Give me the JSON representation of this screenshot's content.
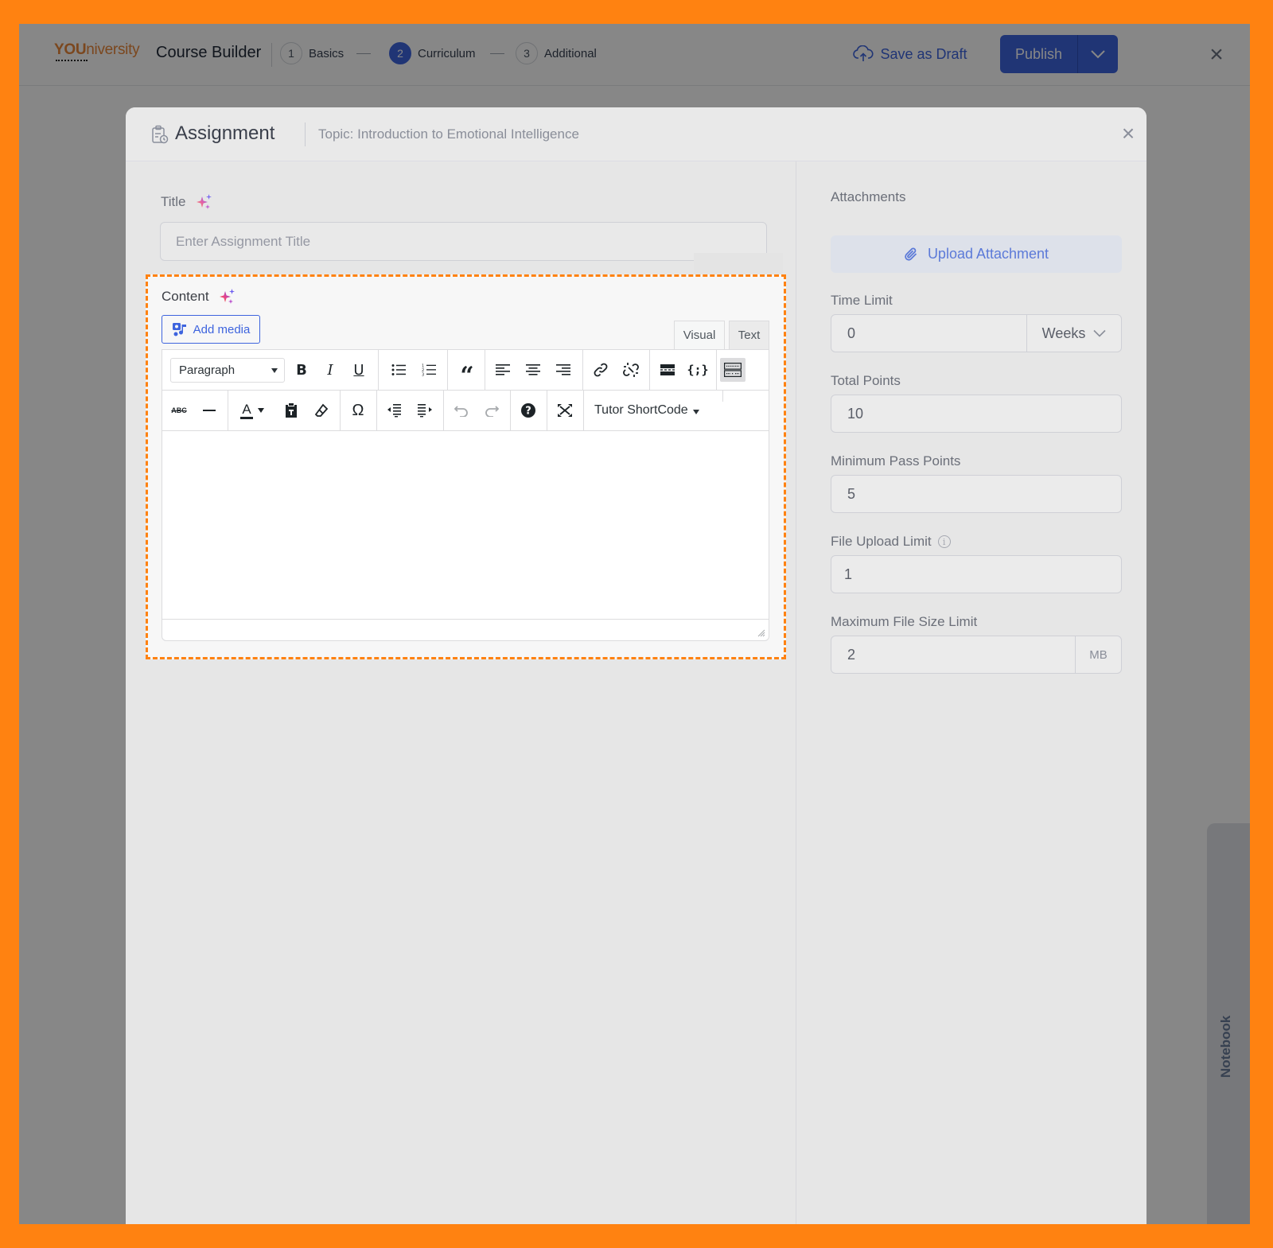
{
  "app": {
    "logo": {
      "bold": "YOU",
      "rest": "niversity"
    },
    "title": "Course Builder",
    "steps": [
      {
        "num": "1",
        "label": "Basics",
        "active": false
      },
      {
        "num": "2",
        "label": "Curriculum",
        "active": true
      },
      {
        "num": "3",
        "label": "Additional",
        "active": false
      }
    ],
    "save_draft_label": "Save as Draft",
    "publish_label": "Publish",
    "close_glyph": "×",
    "accent_color": "#3e64de"
  },
  "modal": {
    "title": "Assignment",
    "topic": "Topic: Introduction to Emotional Intelligence",
    "close_glyph": "×",
    "title_field": {
      "label": "Title",
      "value": "",
      "placeholder": "Enter Assignment Title"
    },
    "content_field": {
      "label": "Content",
      "add_media_label": "Add media",
      "tabs": [
        {
          "label": "Visual",
          "active": true
        },
        {
          "label": "Text",
          "active": false
        }
      ],
      "format_select": "Paragraph",
      "shortcode_label": "Tutor ShortCode",
      "toolbar_row1": [
        "format-select",
        "bold",
        "italic",
        "underline",
        "bullet-list",
        "numbered-list",
        "blockquote",
        "align-left",
        "align-center",
        "align-right",
        "insert-link",
        "remove-link",
        "read-more",
        "code-snippet",
        "toolbar-toggle"
      ],
      "toolbar_row2": [
        "strikethrough",
        "horizontal-line",
        "text-color",
        "paste-as-text",
        "clear-formatting",
        "special-character",
        "outdent",
        "indent",
        "undo",
        "redo",
        "keyboard-shortcuts",
        "fullscreen",
        "tutor-shortcode"
      ],
      "body": ""
    },
    "attachments": {
      "label": "Attachments",
      "upload_label": "Upload Attachment"
    },
    "time_limit": {
      "label": "Time Limit",
      "value": "0",
      "unit": "Weeks"
    },
    "total_points": {
      "label": "Total Points",
      "value": "10"
    },
    "min_pass_points": {
      "label": "Minimum Pass Points",
      "value": "5"
    },
    "file_upload_limit": {
      "label": "File Upload Limit",
      "value": "1"
    },
    "max_file_size": {
      "label": "Maximum File Size Limit",
      "value": "2",
      "unit": "MB"
    }
  },
  "notebook": {
    "label": "Notebook"
  }
}
